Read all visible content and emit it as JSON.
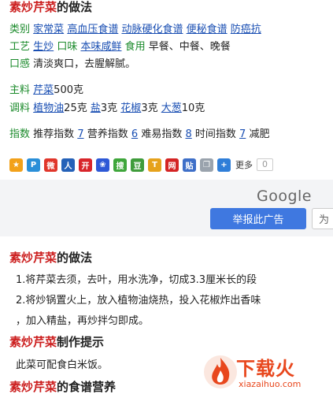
{
  "dish_name": "素炒芹菜",
  "title_suffix": "的做法",
  "info": {
    "category_label": "类别",
    "categories": [
      "家常菜",
      "高血压食谱",
      "动脉硬化食谱",
      "便秘食谱",
      "防癌抗"
    ],
    "craft_label": "工艺",
    "craft": "生炒",
    "taste_label_inline": "口味",
    "taste_value": "本味咸鲜",
    "usage_label": "食用",
    "usage_value": "早餐、中餐、晚餐",
    "mouthfeel_label": "口感",
    "mouthfeel_value": "清淡爽口，去腥解腻。"
  },
  "ingredients": {
    "main_label": "主料",
    "main_item": "芹菜",
    "main_amount": "500克",
    "seasoning_label": "调料",
    "seasonings": [
      {
        "name": "植物油",
        "amount": "25克"
      },
      {
        "name": "盐",
        "amount": "3克"
      },
      {
        "name": "花椒",
        "amount": "3克"
      },
      {
        "name": "大葱",
        "amount": "10克"
      }
    ]
  },
  "index": {
    "label": "指数",
    "items": [
      {
        "name": "推荐指数",
        "value": "7"
      },
      {
        "name": "营养指数",
        "value": "6"
      },
      {
        "name": "难易指数",
        "value": "8"
      },
      {
        "name": "时间指数",
        "value": "7"
      }
    ],
    "trailing": "减肥"
  },
  "share": {
    "more_label": "更多",
    "count": "0",
    "icons": [
      {
        "name": "qzone-icon",
        "color": "#f2a11a",
        "glyph": "★"
      },
      {
        "name": "tencent-weibo-icon",
        "color": "#2a8fd8",
        "glyph": "P"
      },
      {
        "name": "sina-weibo-icon",
        "color": "#e0362b",
        "glyph": "微"
      },
      {
        "name": "renren-icon",
        "color": "#2461b8",
        "glyph": "人"
      },
      {
        "name": "kaixin-icon",
        "color": "#d8252b",
        "glyph": "开"
      },
      {
        "name": "baidu-icon",
        "color": "#2d58d6",
        "glyph": "❀"
      },
      {
        "name": "sohu-icon",
        "color": "#3fa63b",
        "glyph": "搜"
      },
      {
        "name": "douban-icon",
        "color": "#3f9c3b",
        "glyph": "豆"
      },
      {
        "name": "tianya-icon",
        "color": "#e6a21c",
        "glyph": "T"
      },
      {
        "name": "netease-icon",
        "color": "#d42424",
        "glyph": "网"
      },
      {
        "name": "baidu-tieba-icon",
        "color": "#3e6fc8",
        "glyph": "贴"
      },
      {
        "name": "copy-icon",
        "color": "#9aa3ad",
        "glyph": "❐"
      },
      {
        "name": "plus-icon",
        "color": "#2f7ed8",
        "glyph": "+"
      }
    ]
  },
  "ad": {
    "brand": "Google",
    "report_button": "举报此广告",
    "why_button": "为"
  },
  "method": {
    "title_suffix": "的做法",
    "step1": "1.将芹菜去须，去叶，用水洗净，切成3.3厘米长的段",
    "step2": "2.将炒锅置火上，放入植物油烧热，投入花椒炸出香味",
    "step2_cont": "，加入精盐，再炒拌匀即成。"
  },
  "tips": {
    "title_suffix": "制作提示",
    "text": "此菜可配食白米饭。"
  },
  "nutrition": {
    "title_suffix": "的食谱营养"
  },
  "watermark": {
    "text": "下载火",
    "sub": "xiazaihuo.com"
  }
}
